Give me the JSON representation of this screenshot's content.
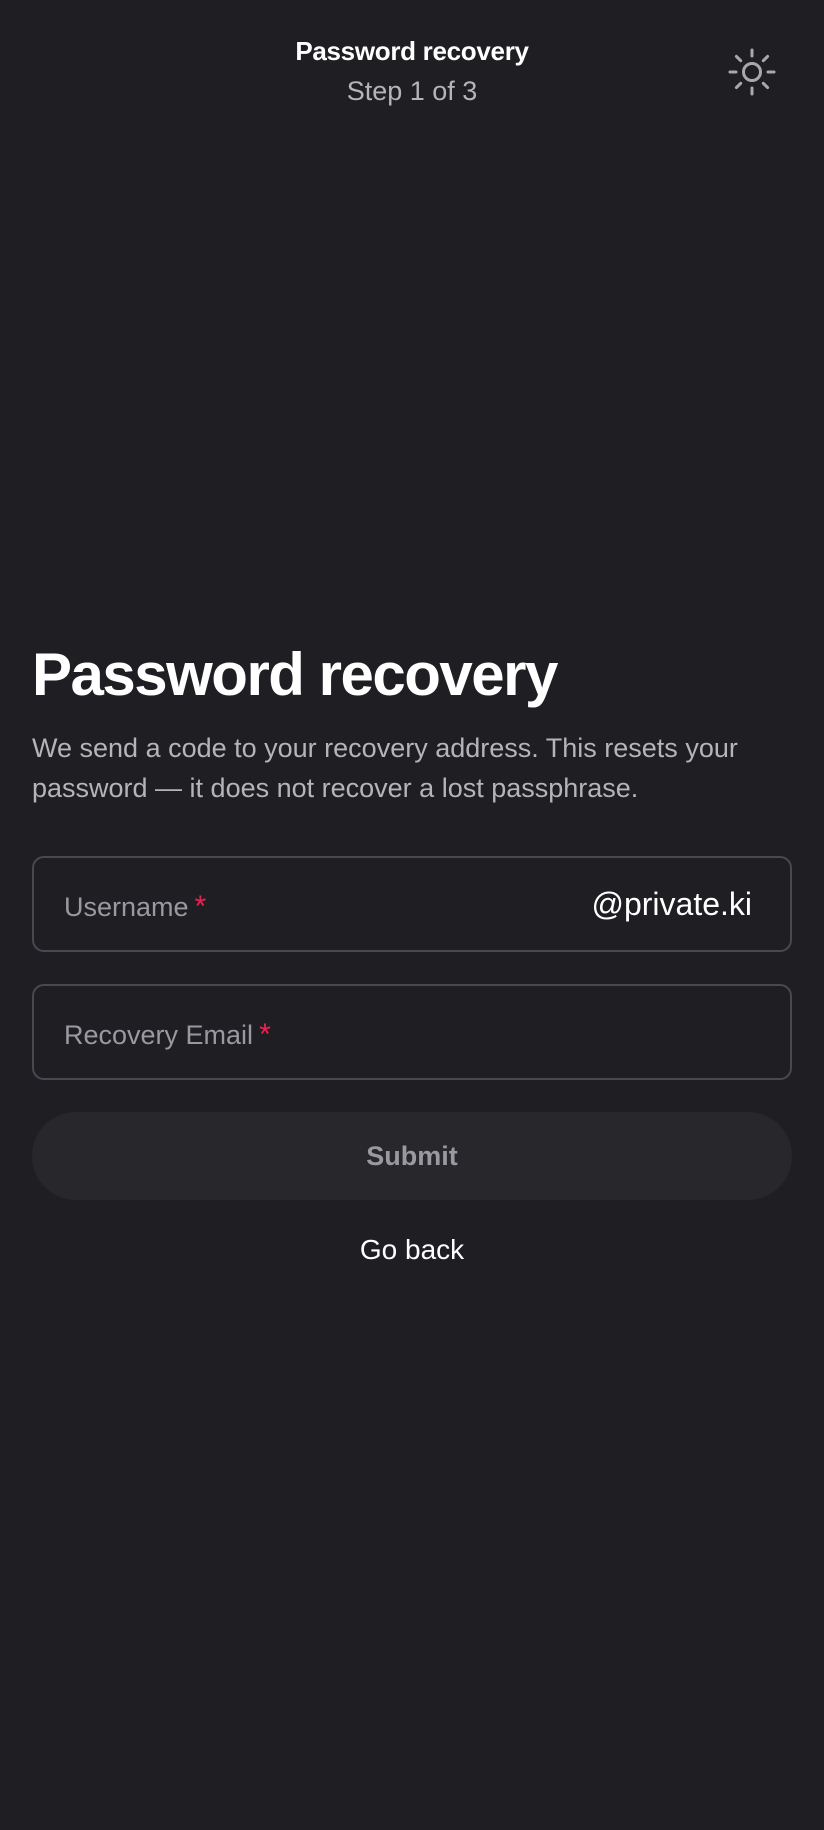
{
  "header": {
    "title": "Password recovery",
    "step": "Step 1 of 3",
    "theme_toggle_icon": "sun-icon"
  },
  "main": {
    "title": "Password recovery",
    "description": "We send a code to your recovery address. This resets your password — it does not recover a lost passphrase."
  },
  "form": {
    "username": {
      "label": "Username",
      "required_mark": "*",
      "value": "",
      "suffix": "@private.ki"
    },
    "recovery_email": {
      "label": "Recovery Email",
      "required_mark": "*",
      "value": ""
    },
    "submit_label": "Submit",
    "go_back_label": "Go back"
  },
  "colors": {
    "background": "#1f1e23",
    "text_primary": "#ffffff",
    "text_secondary": "#b5b4b9",
    "placeholder": "#9a999f",
    "required": "#e8234f",
    "field_border": "#4a4950",
    "button_disabled_bg": "#28272c"
  }
}
